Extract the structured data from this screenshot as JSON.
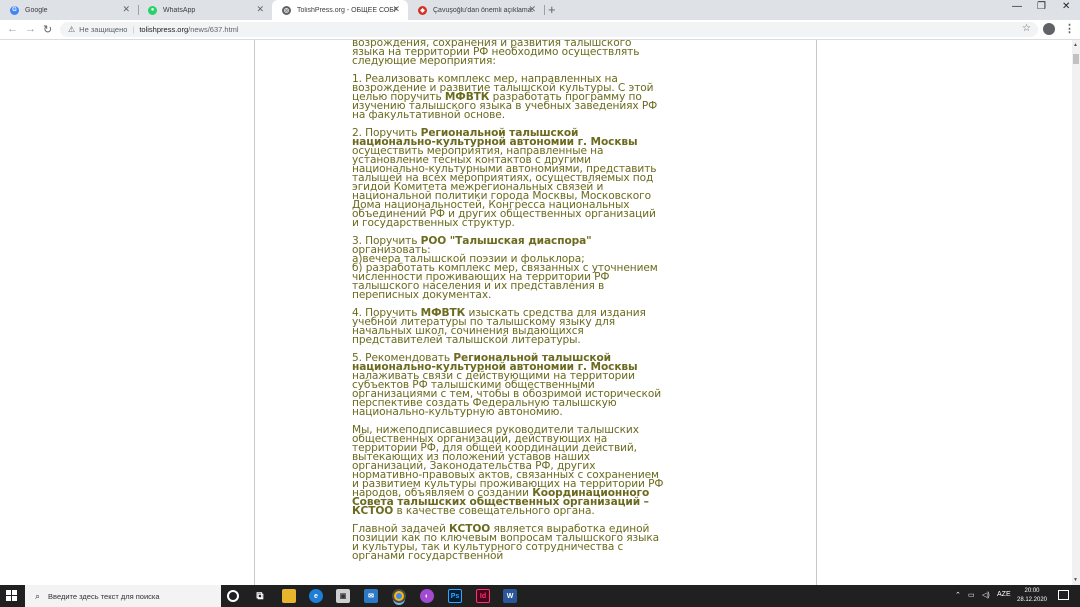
{
  "tabs": [
    {
      "label": "Google",
      "icon": "google-icon",
      "color": "#4285f4"
    },
    {
      "label": "WhatsApp",
      "icon": "whatsapp-icon",
      "color": "#25d366"
    },
    {
      "label": "TolishPress.org - ОБЩЕЕ СОБРАН",
      "icon": "globe-icon",
      "color": "#5f6368"
    },
    {
      "label": "Çavuşoğlu'dan önemli açıklama:",
      "icon": "news-icon",
      "color": "#d93025"
    }
  ],
  "toolbar": {
    "security_label": "Не защищено",
    "url_domain": "tolishpress.org",
    "url_path": "/news/637.html"
  },
  "article": {
    "p0": "возрождения, сохранения и  развития талышского языка на территории РФ необходимо осуществлять  следующие мероприятия:",
    "p1_a": "1. Реализовать комплекс мер, направленных на возрождение и развитие талышской культуры. С этой целью поручить ",
    "p1_b": "МФВТК",
    "p1_c": " разработать программу по изучению талышского языка в учебных заведениях РФ на факультативной основе.",
    "p2_a": "2. Поручить ",
    "p2_b": "Региональной талышской национально-культурной автономии г. Москвы",
    "p2_c": " осуществить мероприятия, направленные на установление тесных контактов с другими национально-культурными автономиями, представить талышей на всех мероприятиях, осуществляемых под эгидой Комитета межрегиональных связей и национальной политики города Москвы, Московского Дома национальностей, Конгресса национальных объединений РФ и других общественных организаций и государственных структур.",
    "p3_a": "3. Поручить ",
    "p3_b": "РОО \"Талышская диаспора\"",
    "p3_c": " организовать:",
    "p3_d": "а)вечера талышской поэзии и фольклора;",
    "p3_e": "б) разработать комплекс мер, связанных с уточнением численности проживающих на территории РФ талышского населения и их представления в переписных документах.",
    "p4_a": "4. Поручить ",
    "p4_b": "МФВТК",
    "p4_c": " изыскать средства для издания учебной литературы по талышскому языку для начальных школ, сочинения выдающихся представителей талышской литературы.",
    "p5_a": "5. Рекомендовать ",
    "p5_b": "Региональной талышской национально-культурной автономии г. Москвы",
    "p5_c": " налаживать связи с действующими на территории субъектов РФ талышскими общественными организациями с тем, чтобы в обозримой исторической перспективе создать Федеральную талышскую национально-культурную автономию.",
    "p6_a": "  Мы, нижеподписавшиеся руководители талышских общественных  организаций, действующих на территории РФ, для общей координации  действий, вытекающих из положений уставов наших организаций,  Законодательства РФ, других нормативно-правовых актов, связанных с  сохранением и развитием культуры проживающих на территории РФ  народов, объявляем о создании ",
    "p6_b": "Координационного Совета талышских  общественных организаций – КСТОО",
    "p6_c": " в качестве совещательного органа.",
    "p7_a": "  Главной задачей ",
    "p7_b": "КСТОО",
    "p7_c": " является выработка единой позиции как по  ключевым вопросам талышского языка и культуры, так и культурного сотрудничества с органами государственной"
  },
  "taskbar": {
    "search_placeholder": "Введите здесь текст для поиска",
    "language": "AZE",
    "time": "20:00",
    "date": "28.12.2020"
  },
  "colors": {
    "article_text": "#6b6a1e",
    "taskbar_bg": "#202020",
    "tabstrip_bg": "#dee1e6"
  }
}
